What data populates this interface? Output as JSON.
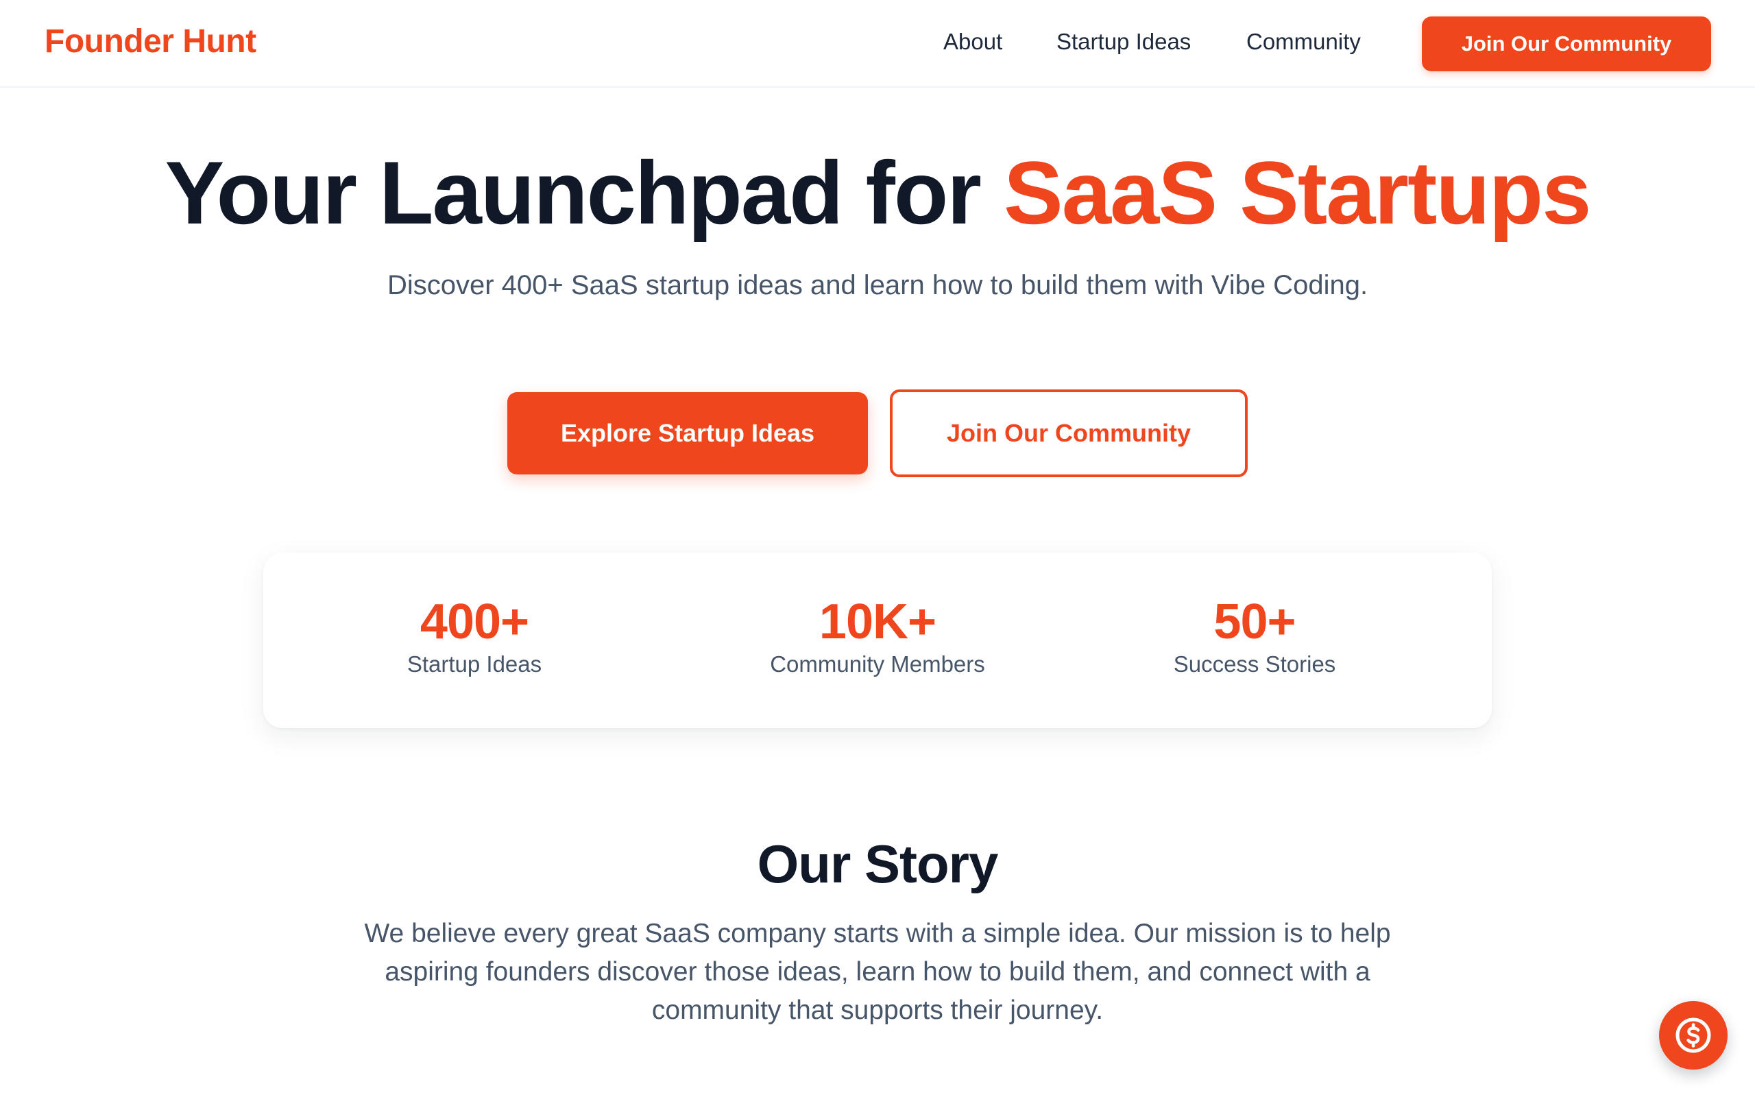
{
  "header": {
    "logo": "Founder Hunt",
    "nav": {
      "about": "About",
      "startup_ideas": "Startup Ideas",
      "community": "Community"
    },
    "cta_label": "Join Our Community"
  },
  "hero": {
    "title_main": "Your Launchpad for ",
    "title_accent": "SaaS Startups",
    "subtitle": "Discover 400+ SaaS startup ideas and learn how to build them with Vibe Coding.",
    "primary_button": "Explore Startup Ideas",
    "secondary_button": "Join Our Community"
  },
  "stats": [
    {
      "value": "400+",
      "label": "Startup Ideas"
    },
    {
      "value": "10K+",
      "label": "Community Members"
    },
    {
      "value": "50+",
      "label": "Success Stories"
    }
  ],
  "story": {
    "title": "Our Story",
    "text": "We believe every great SaaS company starts with a simple idea. Our mission is to help aspiring founders discover those ideas, learn how to build them, and connect with a community that supports their journey."
  },
  "floating_button": {
    "icon": "dollar-circle-icon"
  },
  "colors": {
    "accent": "#f0461e",
    "heading": "#111827",
    "body_text": "#475569"
  }
}
